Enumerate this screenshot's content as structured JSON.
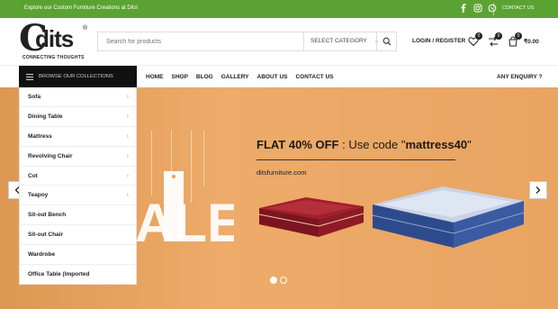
{
  "topbar": {
    "promo": "Explore our Custom Furniture Creations at Dits!",
    "social_icons": [
      "facebook-icon",
      "instagram-icon",
      "whatsapp-icon"
    ],
    "contact": "CONTACT US"
  },
  "logo": {
    "letter": "C",
    "name": "dits",
    "reg": "®",
    "tagline": "CONNECTING THOUGHTS"
  },
  "search": {
    "placeholder": "Search for products",
    "category_label": "SELECT CATEGORY"
  },
  "header": {
    "login": "LOGIN / REGISTER",
    "wishlist_count": "0",
    "compare_count": "0",
    "cart_count": "0",
    "cart_total": "₹0.00"
  },
  "nav": {
    "browse": "BROWSE OUR COLLECTIONS",
    "items": [
      "HOME",
      "SHOP",
      "BLOG",
      "GALLERY",
      "ABOUT US",
      "CONTACT US"
    ],
    "enquiry": "ANY ENQUIRY ?"
  },
  "categories": [
    {
      "label": "Sofa",
      "has_sub": true
    },
    {
      "label": "Dining Table",
      "has_sub": true
    },
    {
      "label": "Mattress",
      "has_sub": true
    },
    {
      "label": "Revolving Chair",
      "has_sub": true
    },
    {
      "label": "Cot",
      "has_sub": true
    },
    {
      "label": "Teapoy",
      "has_sub": true
    },
    {
      "label": "Sit-out Bench",
      "has_sub": false
    },
    {
      "label": "Sit-out Chair",
      "has_sub": false
    },
    {
      "label": "Wardrobe",
      "has_sub": false
    },
    {
      "label": "Office Table (Imported",
      "has_sub": false
    }
  ],
  "hero": {
    "offer_prefix": "FLAT 40% OFF",
    "offer_middle": " : Use code \"",
    "offer_code": "mattress40",
    "offer_suffix": "\"",
    "site": "ditsfurniture.com",
    "sale_text": "ALE",
    "slides": 2,
    "active_slide": 1
  },
  "colors": {
    "topbar": "#5aa332",
    "hero_bg": "#e8a35f",
    "browse_bg": "#111111"
  }
}
